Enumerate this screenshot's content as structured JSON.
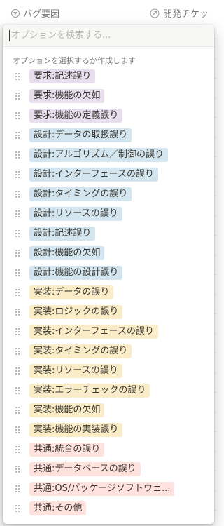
{
  "header": {
    "property_left_label": "バグ要因",
    "property_right_label": "開発チケッ"
  },
  "search": {
    "placeholder": "オプションを検索する..."
  },
  "hint": "オプションを選択するか作成します",
  "colors": {
    "purple": "#e8deee",
    "blue": "#d3e5ef",
    "yellow": "#fbecc8",
    "red": "#ffe2dd"
  },
  "options": [
    {
      "label": "要求:記述誤り",
      "color": "purple"
    },
    {
      "label": "要求:機能の欠如",
      "color": "purple"
    },
    {
      "label": "要求:機能の定義誤り",
      "color": "purple"
    },
    {
      "label": "設計:データの取扱誤り",
      "color": "blue"
    },
    {
      "label": "設計:アルゴリズム／制御の誤り",
      "color": "blue"
    },
    {
      "label": "設計:インターフェースの誤り",
      "color": "blue"
    },
    {
      "label": "設計:タイミングの誤り",
      "color": "blue"
    },
    {
      "label": "設計:リソースの誤り",
      "color": "blue"
    },
    {
      "label": "設計:記述誤り",
      "color": "blue"
    },
    {
      "label": "設計:機能の欠如",
      "color": "blue"
    },
    {
      "label": "設計:機能の設計誤り",
      "color": "blue"
    },
    {
      "label": "実装:データの誤り",
      "color": "yellow"
    },
    {
      "label": "実装:ロジックの誤り",
      "color": "yellow"
    },
    {
      "label": "実装:インターフェースの誤り",
      "color": "yellow"
    },
    {
      "label": "実装:タイミングの誤り",
      "color": "yellow"
    },
    {
      "label": "実装:リソースの誤り",
      "color": "yellow"
    },
    {
      "label": "実装:エラーチェックの誤り",
      "color": "yellow"
    },
    {
      "label": "実装:機能の欠如",
      "color": "yellow"
    },
    {
      "label": "実装:機能の実装誤り",
      "color": "yellow"
    },
    {
      "label": "共通:統合の誤り",
      "color": "red"
    },
    {
      "label": "共通:データベースの誤り",
      "color": "red"
    },
    {
      "label": "共通:OS/パッケージソフトウェ...",
      "color": "red"
    },
    {
      "label": "共通:その他",
      "color": "red"
    }
  ]
}
